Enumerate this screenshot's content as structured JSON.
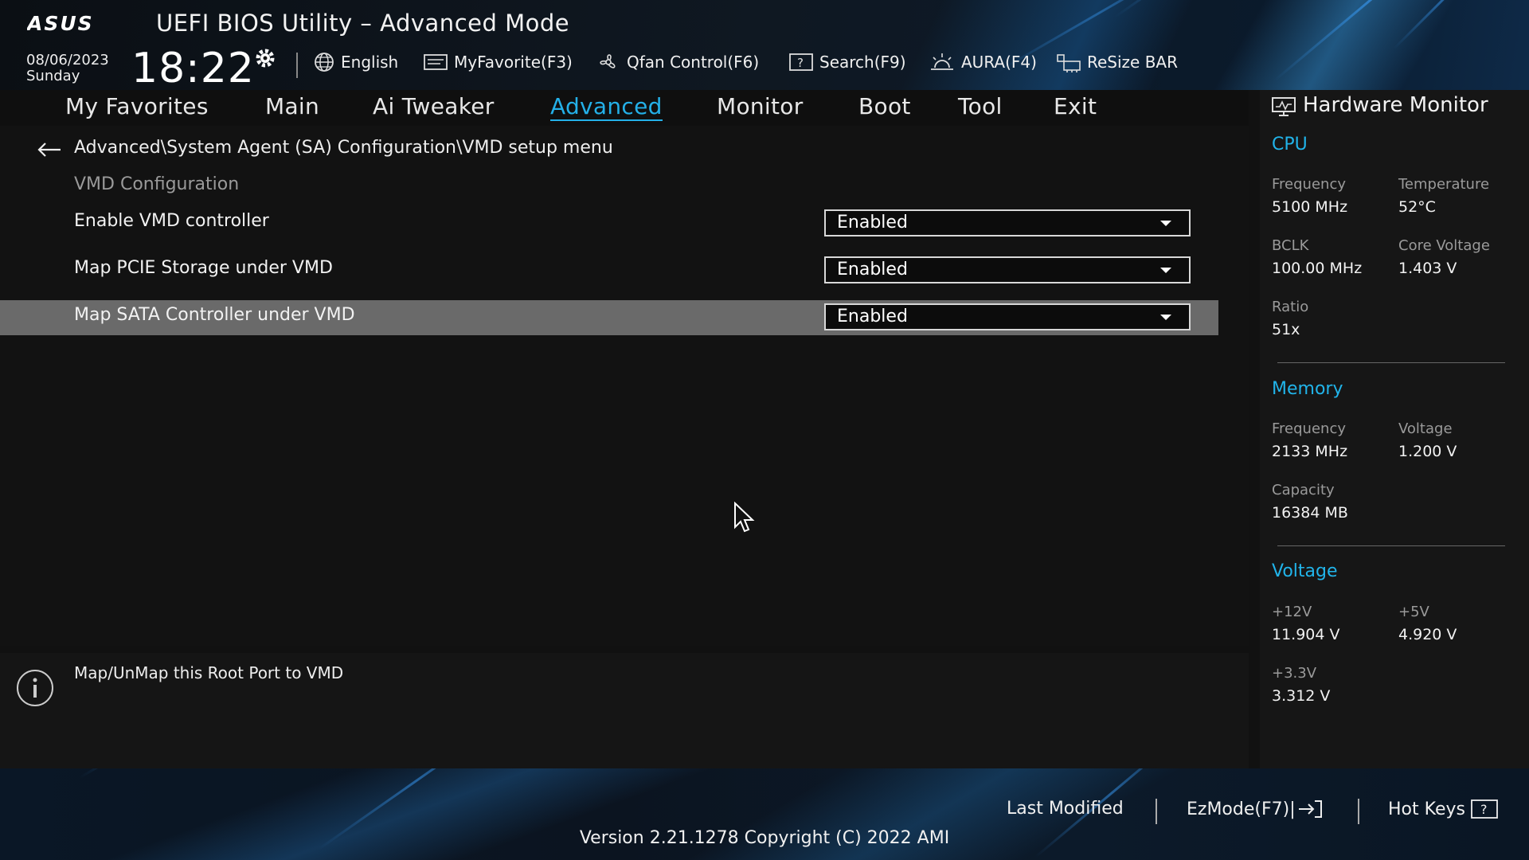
{
  "header": {
    "brand": "ASUS",
    "title": "UEFI BIOS Utility – Advanced Mode",
    "date": "08/06/2023",
    "weekday": "Sunday",
    "time": "18:22",
    "items": [
      {
        "label": "English",
        "icon": "globe-icon"
      },
      {
        "label": "MyFavorite(F3)",
        "icon": "favorite-icon"
      },
      {
        "label": "Qfan Control(F6)",
        "icon": "fan-icon"
      },
      {
        "label": "Search(F9)",
        "icon": "search-icon"
      },
      {
        "label": "AURA(F4)",
        "icon": "aura-icon"
      },
      {
        "label": "ReSize BAR",
        "icon": "resize-bar-icon"
      }
    ]
  },
  "tabs": [
    {
      "label": "My Favorites",
      "active": false
    },
    {
      "label": "Main",
      "active": false
    },
    {
      "label": "Ai Tweaker",
      "active": false
    },
    {
      "label": "Advanced",
      "active": true
    },
    {
      "label": "Monitor",
      "active": false
    },
    {
      "label": "Boot",
      "active": false
    },
    {
      "label": "Tool",
      "active": false
    },
    {
      "label": "Exit",
      "active": false
    }
  ],
  "main": {
    "breadcrumb": "Advanced\\System Agent (SA) Configuration\\VMD setup menu",
    "section_title": "VMD Configuration",
    "options": [
      {
        "label": "Enable VMD controller",
        "value": "Enabled",
        "selected": false
      },
      {
        "label": "Map PCIE Storage under VMD",
        "value": "Enabled",
        "selected": false
      },
      {
        "label": "Map SATA Controller under VMD",
        "value": "Enabled",
        "selected": true
      }
    ]
  },
  "help": {
    "text": "Map/UnMap this Root Port to VMD"
  },
  "hardware_monitor": {
    "title": "Hardware Monitor",
    "cpu": {
      "heading": "CPU",
      "frequency_label": "Frequency",
      "frequency": "5100 MHz",
      "temperature_label": "Temperature",
      "temperature": "52°C",
      "bclk_label": "BCLK",
      "bclk": "100.00 MHz",
      "core_voltage_label": "Core Voltage",
      "core_voltage": "1.403 V",
      "ratio_label": "Ratio",
      "ratio": "51x"
    },
    "memory": {
      "heading": "Memory",
      "frequency_label": "Frequency",
      "frequency": "2133 MHz",
      "voltage_label": "Voltage",
      "voltage": "1.200 V",
      "capacity_label": "Capacity",
      "capacity": "16384 MB"
    },
    "voltage": {
      "heading": "Voltage",
      "v12_label": "+12V",
      "v12": "11.904 V",
      "v5_label": "+5V",
      "v5": "4.920 V",
      "v33_label": "+3.3V",
      "v33": "3.312 V"
    }
  },
  "footer": {
    "last_modified": "Last Modified",
    "ezmode": "EzMode(F7)|",
    "hotkeys": "Hot Keys",
    "version": "Version 2.21.1278 Copyright (C) 2022 AMI"
  },
  "colors": {
    "accent": "#24b0e8",
    "selected_row": "#6a6a6a",
    "background": "#121212"
  }
}
